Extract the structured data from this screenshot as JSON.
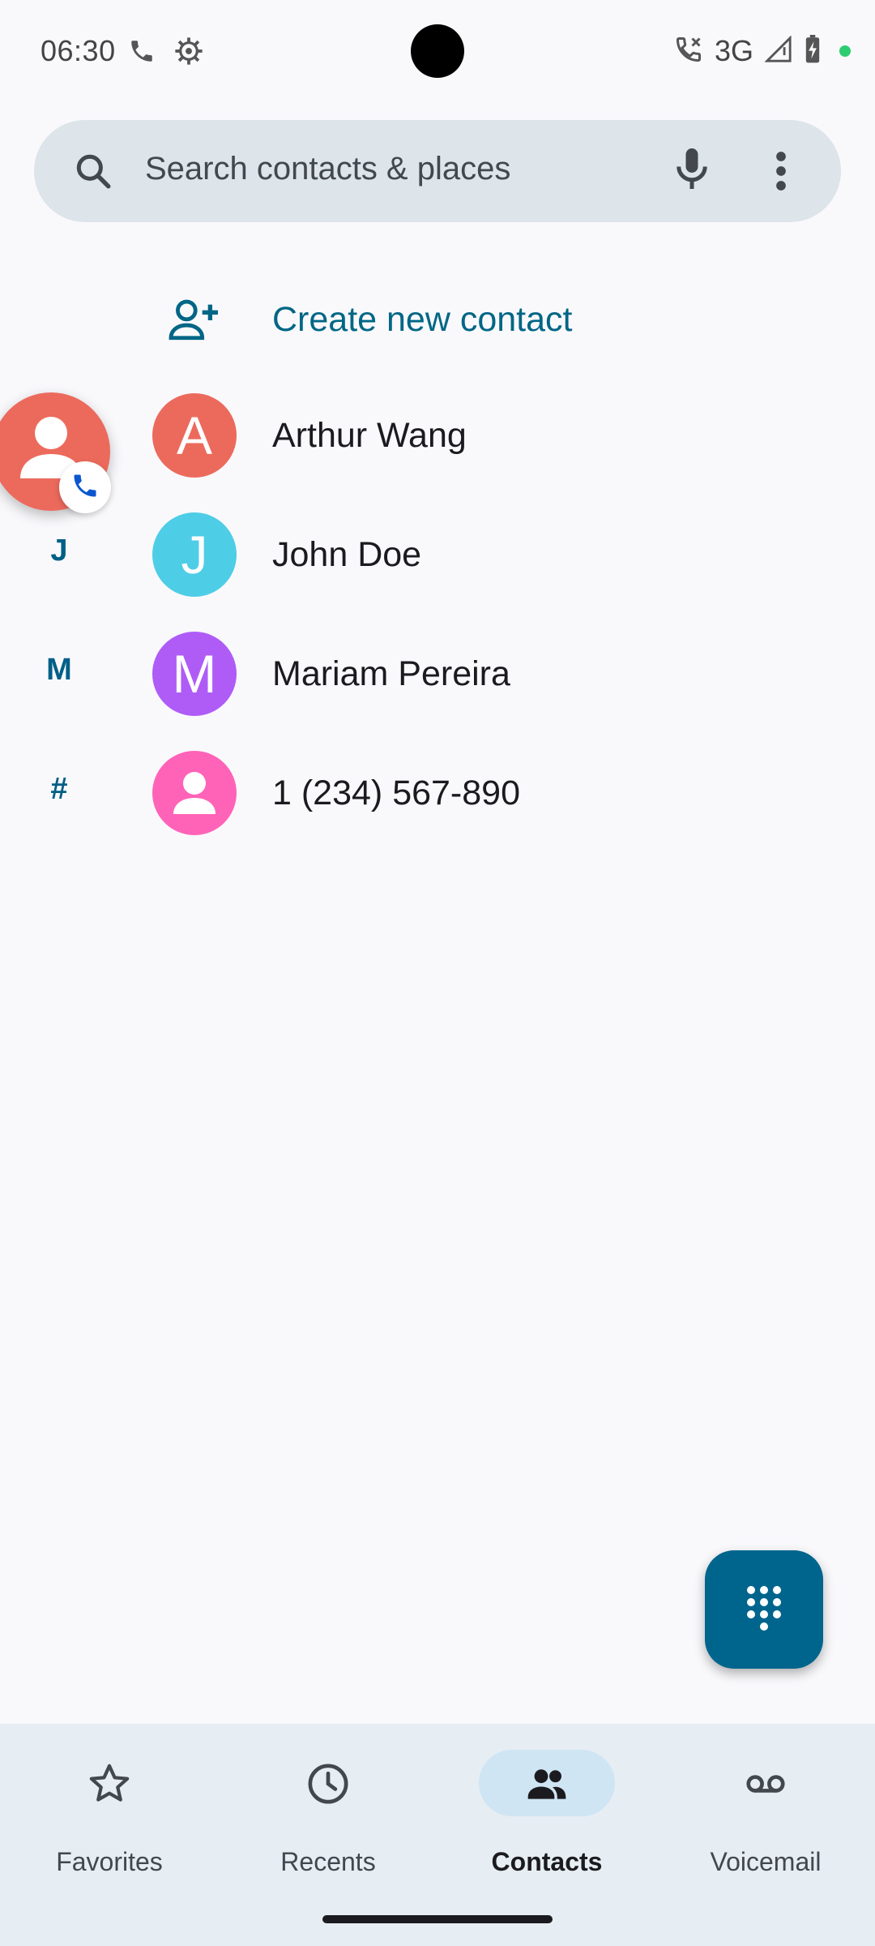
{
  "status_bar": {
    "time": "06:30",
    "network": "3G",
    "icons": [
      "phone-icon",
      "settings-gear-icon",
      "call-active-icon",
      "signal-icon",
      "battery-charging-icon"
    ]
  },
  "search": {
    "placeholder": "Search contacts & places",
    "icons": [
      "search-icon",
      "microphone-icon",
      "more-vert-icon"
    ]
  },
  "create_contact": {
    "label": "Create new contact",
    "icon": "person-add-icon"
  },
  "contacts": [
    {
      "section": "",
      "initial": "A",
      "name": "Arthur Wang",
      "color": "#ec6a5c"
    },
    {
      "section": "J",
      "initial": "J",
      "name": "John Doe",
      "color": "#4ecde6"
    },
    {
      "section": "M",
      "initial": "M",
      "name": "Mariam Pereira",
      "color": "#af5cf7"
    },
    {
      "section": "#",
      "initial": "",
      "name": "1 (234) 567-890",
      "color": "#ff63b8"
    }
  ],
  "call_bubble": {
    "color": "#ec6a5c",
    "badge_icon": "phone-icon",
    "badge_color": "#0b57d0"
  },
  "fab": {
    "icon": "dialpad-icon",
    "color": "#00658d"
  },
  "bottom_nav": {
    "items": [
      {
        "label": "Favorites",
        "icon": "star-icon",
        "active": false
      },
      {
        "label": "Recents",
        "icon": "clock-icon",
        "active": false
      },
      {
        "label": "Contacts",
        "icon": "people-icon",
        "active": true
      },
      {
        "label": "Voicemail",
        "icon": "voicemail-icon",
        "active": false
      }
    ]
  },
  "colors": {
    "accent": "#006685",
    "background": "#f9f9fc",
    "search_background": "#dde4ea",
    "nav_background": "#e6edf3",
    "nav_active_pill": "#cfe5f4"
  }
}
